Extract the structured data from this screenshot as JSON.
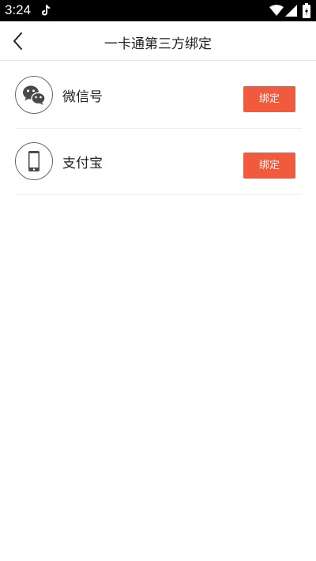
{
  "status_bar": {
    "time": "3:24",
    "icons": [
      "tiktok-icon",
      "wifi-icon",
      "signal-icon",
      "battery-icon"
    ]
  },
  "nav": {
    "back_icon": "chevron-left-icon",
    "title": "一卡通第三方绑定"
  },
  "bindings": [
    {
      "icon": "wechat-icon",
      "label": "微信号",
      "button_label": "绑定"
    },
    {
      "icon": "phone-icon",
      "label": "支付宝",
      "button_label": "绑定"
    }
  ],
  "colors": {
    "accent": "#f05a3d",
    "status_bar_bg": "#000000",
    "icon_gray": "#555555"
  }
}
